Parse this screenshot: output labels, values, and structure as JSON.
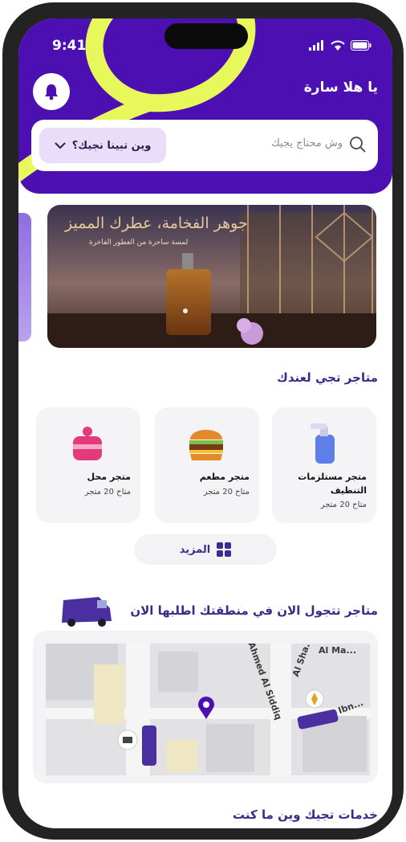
{
  "status_bar": {
    "time": "9:41"
  },
  "header": {
    "greeting": "يا هلا سارة",
    "search_placeholder": "وش محتاج يجيك",
    "location_label": "وين تبينا نجيك؟"
  },
  "banner": {
    "title": "جوهر الفخامة، عطرك المميز",
    "subtitle": "لمسة ساحرة من العطور الفاخرة"
  },
  "stores_section": {
    "title": "متاجر تجي لعندك",
    "cards": [
      {
        "name_line1": "متجر مستلزمات",
        "name_line2": "التنظيف",
        "count": "متاح 20 متجر",
        "icon": "spray-bottle-icon"
      },
      {
        "name_line1": "متجر مطعم",
        "count": "متاح 20 متجر",
        "icon": "burger-icon"
      },
      {
        "name_line1": "متجر محل",
        "count": "متاح 20 متجر",
        "icon": "cake-icon"
      }
    ],
    "more_label": "المزيد"
  },
  "roaming_section": {
    "title": "متاجر تتجول الان في منطقتك اطلبها الان",
    "map_streets": [
      "Al Ma...",
      "Ahmed Al Siddiq",
      "Al Sha...",
      "Ibn..."
    ]
  },
  "services_section": {
    "title": "خدمات تجيك وين ما كنت"
  },
  "colors": {
    "brand_purple": "#4b0fb2",
    "accent_yellow": "#e8f75a",
    "title_purple": "#3a2a8a",
    "card_bg": "#f4f4f6"
  }
}
